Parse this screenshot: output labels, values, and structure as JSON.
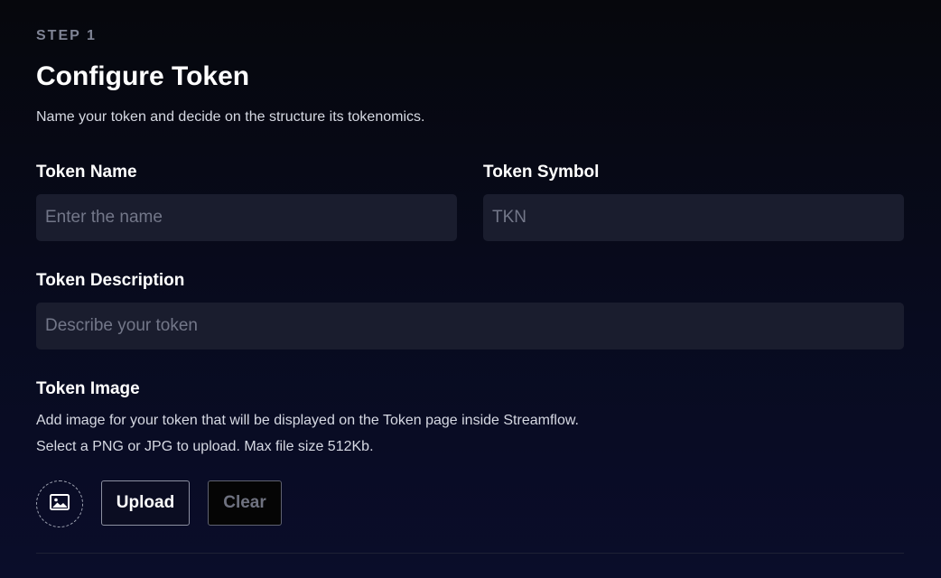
{
  "step": {
    "label": "STEP 1"
  },
  "header": {
    "title": "Configure Token",
    "subtitle": "Name your token and decide on the structure its tokenomics."
  },
  "fields": {
    "name": {
      "label": "Token Name",
      "placeholder": "Enter the name",
      "value": ""
    },
    "symbol": {
      "label": "Token Symbol",
      "placeholder": "TKN",
      "value": ""
    },
    "description": {
      "label": "Token Description",
      "placeholder": "Describe your token",
      "value": ""
    }
  },
  "image": {
    "label": "Token Image",
    "help_line1": "Add image for your token that will be displayed on the Token page inside Streamflow.",
    "help_line2": "Select a PNG or JPG to upload. Max file size 512Kb.",
    "placeholder_icon": "image-icon",
    "upload_label": "Upload",
    "clear_label": "Clear"
  },
  "colors": {
    "background_top": "#06070c",
    "background_bottom": "#0a0d2a",
    "input_bg": "#1a1d2e",
    "muted_text": "#7f8495"
  }
}
